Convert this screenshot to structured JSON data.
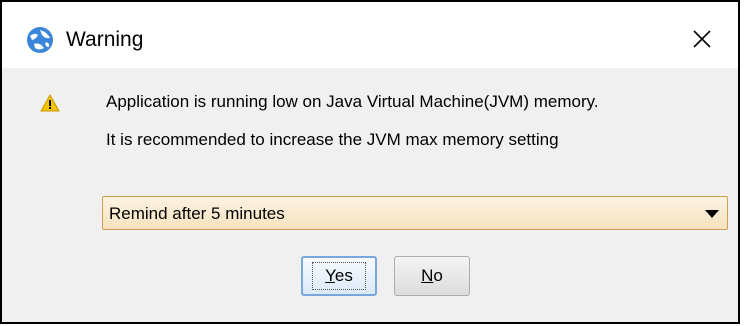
{
  "window": {
    "title": "Warning",
    "app_icon": "globe-app-icon",
    "close_icon": "close-icon"
  },
  "message": {
    "icon": "warning-icon",
    "line1": "Application is running low on Java Virtual Machine(JVM) memory.",
    "line2": "It is recommended to increase the JVM max memory setting"
  },
  "reminder": {
    "selected": "Remind after 5 minutes"
  },
  "buttons": {
    "yes_label": "Yes",
    "no_label": "No"
  },
  "colors": {
    "warning": "#f2c500",
    "dropdown_border": "#d0a050",
    "default_button_border": "#7aa7d9"
  }
}
